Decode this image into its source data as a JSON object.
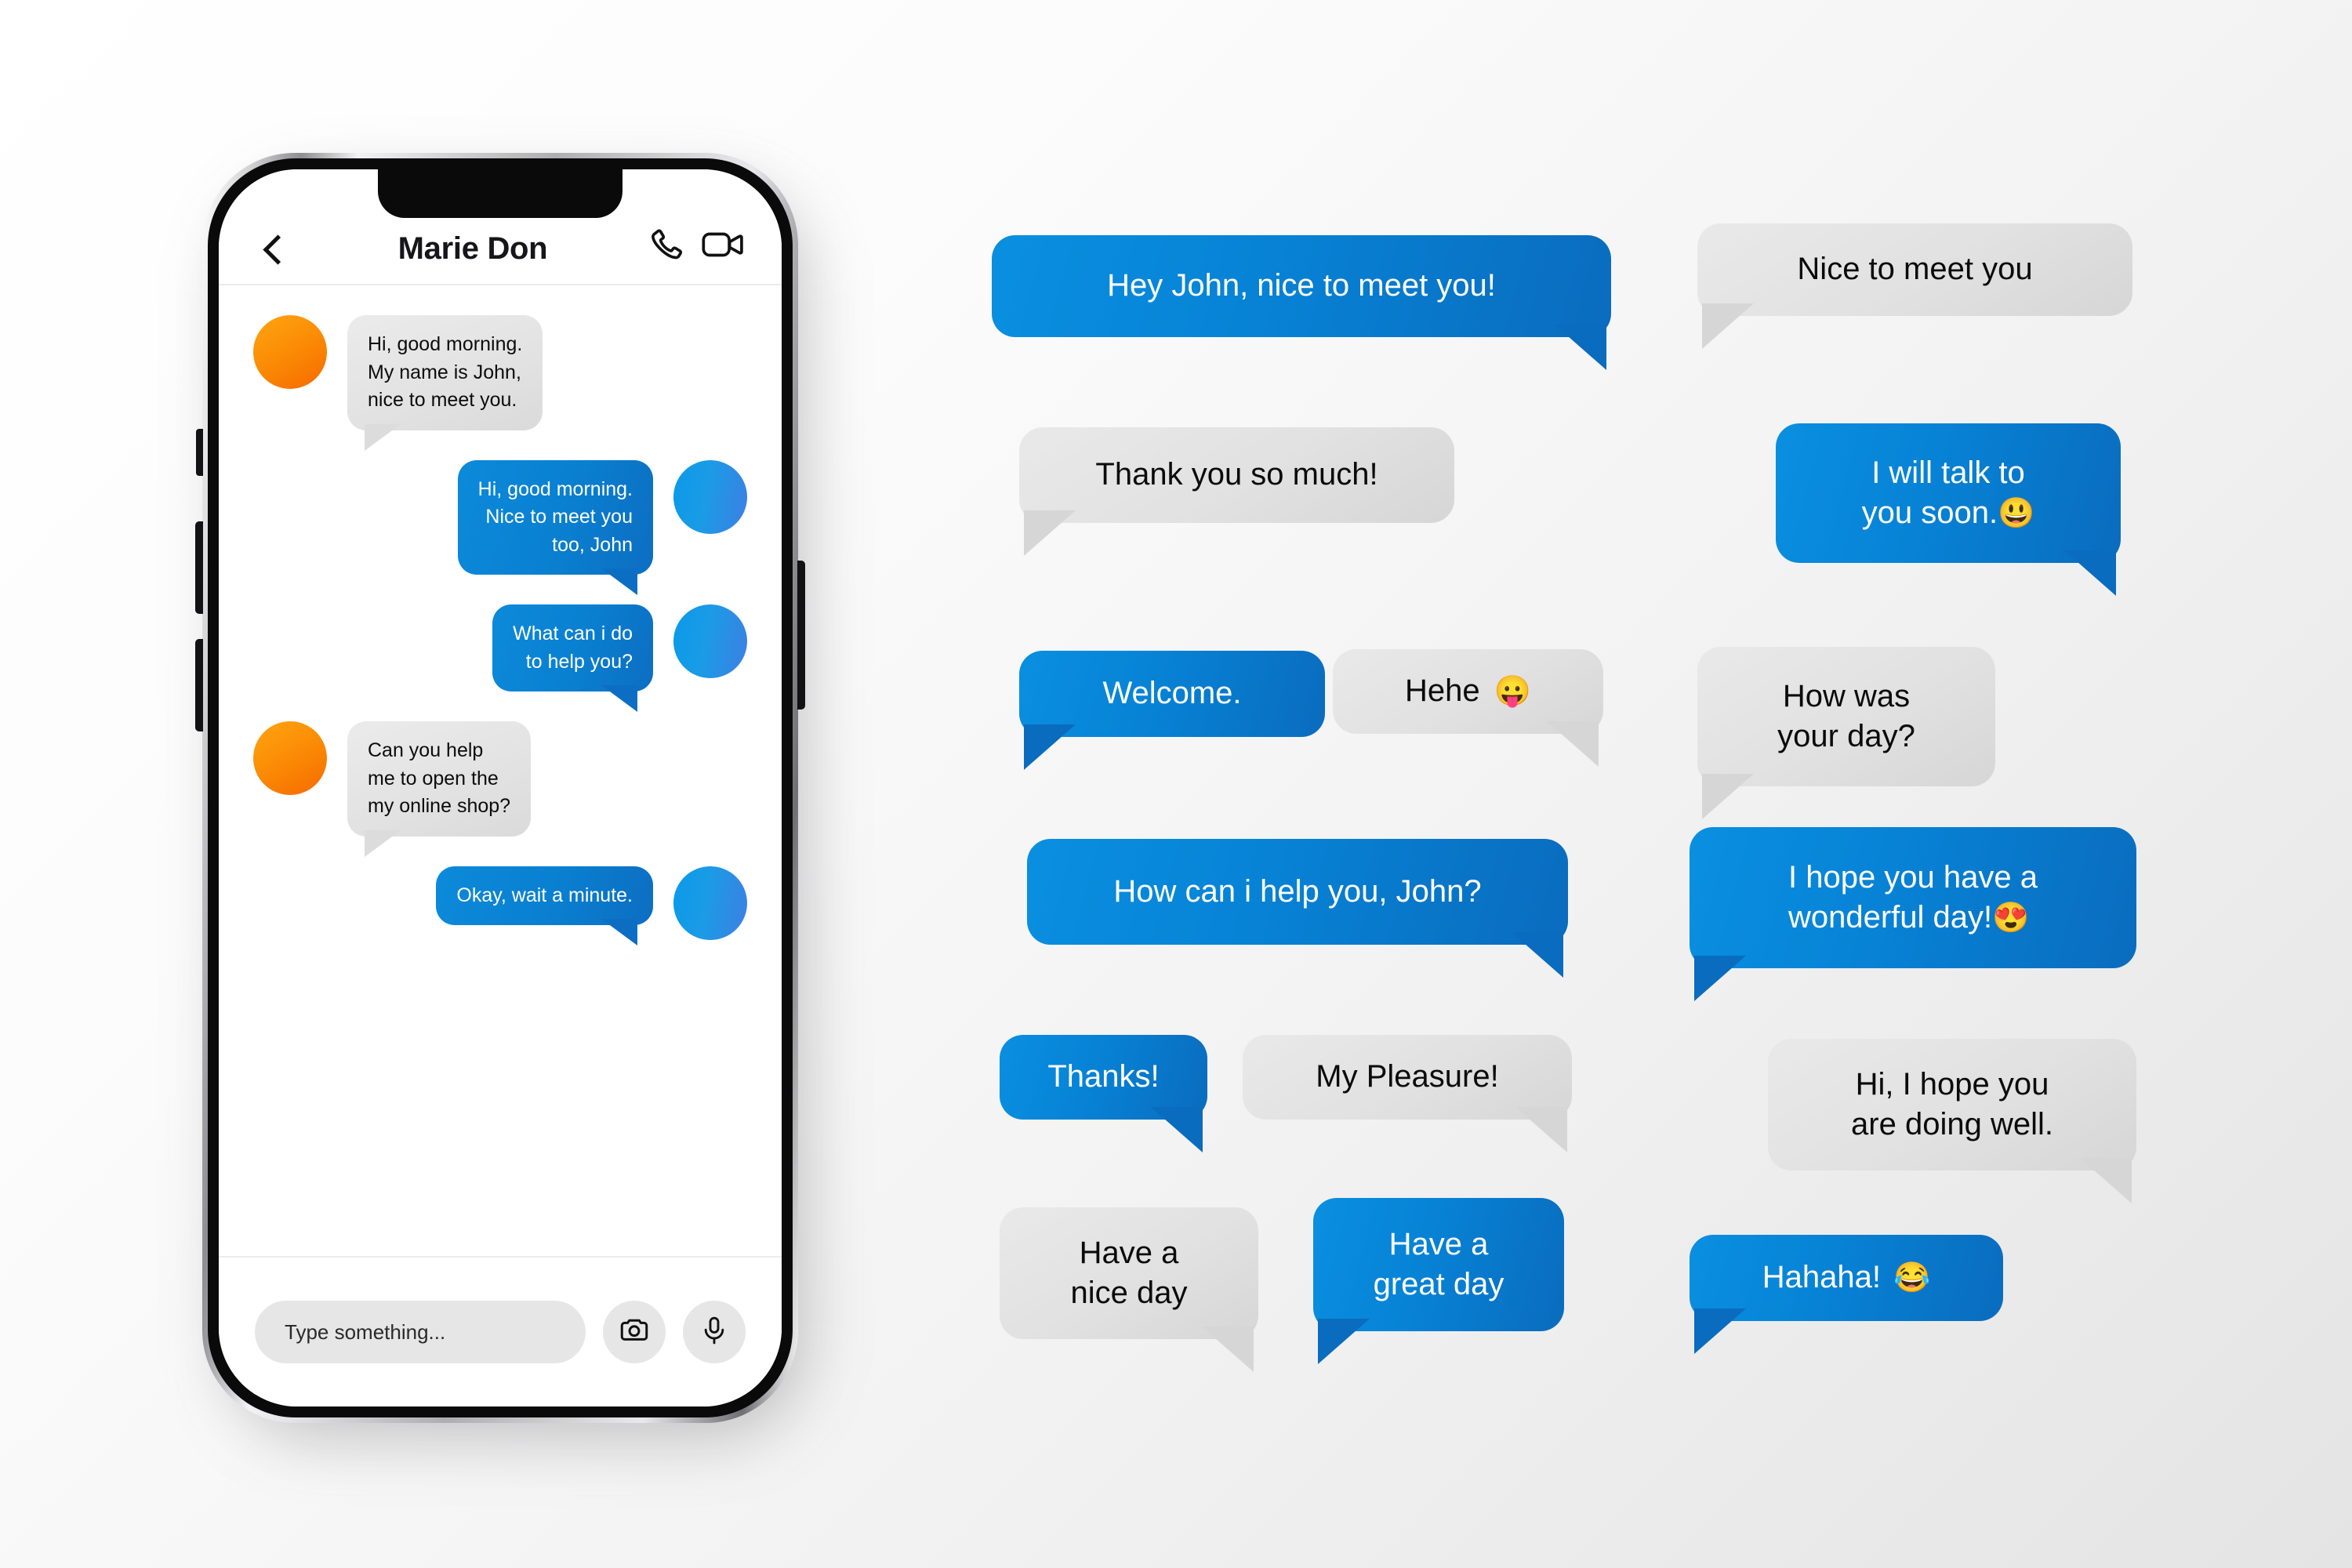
{
  "phone": {
    "header": {
      "back_icon": "back-chevron-icon",
      "contact_name": "Marie Don",
      "call_icon": "phone-call-icon",
      "video_icon": "video-camera-icon"
    },
    "messages": [
      {
        "side": "left",
        "style": "gray",
        "avatar": "orange",
        "text": "Hi, good morning.\nMy name is John,\nnice to meet you."
      },
      {
        "side": "right",
        "style": "blue",
        "avatar": "blue",
        "text": "Hi, good morning.\nNice to meet you\ntoo, John"
      },
      {
        "side": "right",
        "style": "blue",
        "avatar": "blue",
        "text": "What can i do\nto help you?"
      },
      {
        "side": "left",
        "style": "gray",
        "avatar": "orange",
        "text": "Can you help\nme to open the\nmy online shop?"
      },
      {
        "side": "right",
        "style": "blue",
        "avatar": "blue",
        "text": "Okay, wait a minute."
      }
    ],
    "footer": {
      "input_value": "",
      "input_placeholder": "Type something...",
      "camera_icon": "camera-icon",
      "mic_icon": "microphone-icon"
    }
  },
  "bubbles": [
    {
      "id": "hey-john",
      "text": "Hey John, nice to meet you!",
      "style": "blue",
      "tail": "right"
    },
    {
      "id": "nice-to-meet",
      "text": "Nice to meet you",
      "style": "gray",
      "tail": "left"
    },
    {
      "id": "thank-you",
      "text": "Thank you so much!",
      "style": "gray",
      "tail": "left"
    },
    {
      "id": "talk-soon",
      "text": "I will talk to\nyou soon.",
      "style": "blue",
      "tail": "right",
      "emoji": "😃",
      "emoji_name": "grinning-face-emoji"
    },
    {
      "id": "welcome",
      "text": "Welcome.",
      "style": "blue",
      "tail": "left"
    },
    {
      "id": "hehe",
      "text": "Hehe",
      "style": "gray",
      "tail": "right",
      "emoji": "😛",
      "emoji_name": "face-with-tongue-emoji"
    },
    {
      "id": "how-was-day",
      "text": "How was\nyour day?",
      "style": "gray",
      "tail": "left"
    },
    {
      "id": "how-can-help",
      "text": "How can i help you, John?",
      "style": "blue",
      "tail": "right"
    },
    {
      "id": "wonderful-day",
      "text": "I hope you have a\nwonderful day!",
      "style": "blue",
      "tail": "left",
      "emoji": "😍",
      "emoji_name": "smiling-face-with-heart-eyes-emoji"
    },
    {
      "id": "thanks",
      "text": "Thanks!",
      "style": "blue",
      "tail": "right"
    },
    {
      "id": "my-pleasure",
      "text": "My Pleasure!",
      "style": "gray",
      "tail": "right"
    },
    {
      "id": "doing-well",
      "text": "Hi, I hope you\nare doing well.",
      "style": "gray",
      "tail": "right"
    },
    {
      "id": "nice-day",
      "text": "Have a\nnice day",
      "style": "gray",
      "tail": "right"
    },
    {
      "id": "great-day",
      "text": "Have a\ngreat day",
      "style": "blue",
      "tail": "left"
    },
    {
      "id": "hahaha",
      "text": "Hahaha!",
      "style": "blue",
      "tail": "left",
      "emoji": "😂",
      "emoji_name": "face-with-tears-of-joy-emoji"
    }
  ],
  "colors": {
    "blue_light": "#0A8FE0",
    "blue_dark": "#0A6CBE",
    "gray_bubble": "#E1E1E1",
    "avatar_orange": "#FB8C05",
    "avatar_blue": "#1B9BE6",
    "background": "#E4E4E4"
  }
}
